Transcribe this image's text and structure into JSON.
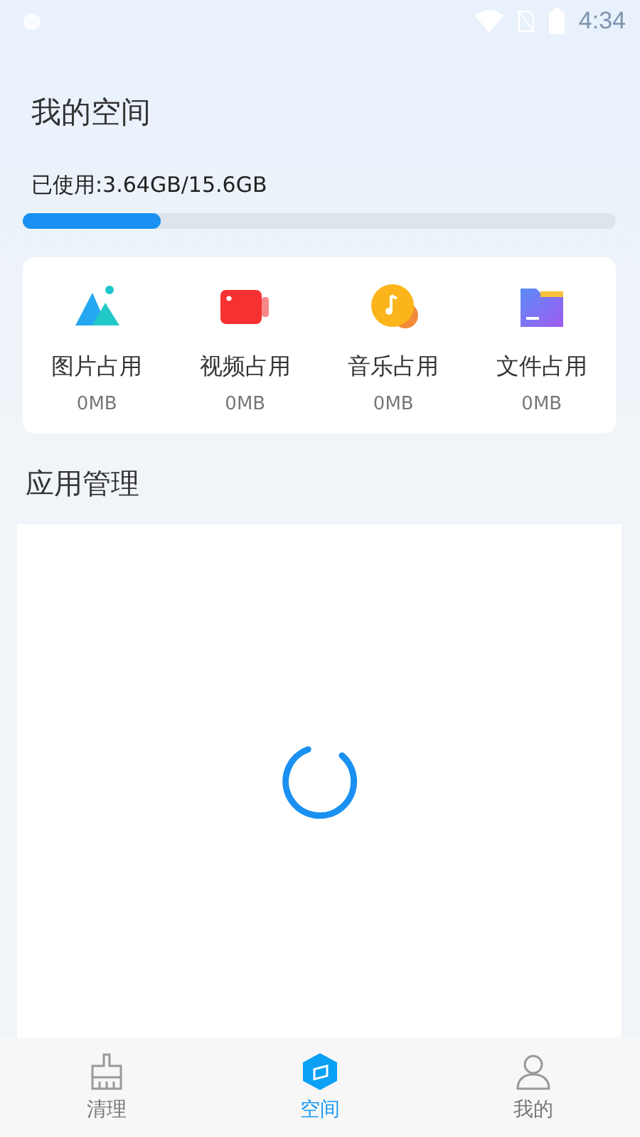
{
  "status_bar": {
    "time": "4:34"
  },
  "header": {
    "title": "我的空间"
  },
  "storage": {
    "used_label": "已使用:3.64GB/15.6GB",
    "level": 0.233
  },
  "categories": [
    {
      "kind": "image",
      "label": "图片占用",
      "size": "0MB"
    },
    {
      "kind": "video",
      "label": "视频占用",
      "size": "0MB"
    },
    {
      "kind": "music",
      "label": "音乐占用",
      "size": "0MB"
    },
    {
      "kind": "file",
      "label": "文件占用",
      "size": "0MB"
    }
  ],
  "app_section": {
    "title": "应用管理",
    "loading": true
  },
  "bottom_nav": [
    {
      "kind": "clean",
      "label": "清理",
      "selected": false
    },
    {
      "kind": "space",
      "label": "空间",
      "selected": true
    },
    {
      "kind": "me",
      "label": "我的",
      "selected": false
    }
  ]
}
